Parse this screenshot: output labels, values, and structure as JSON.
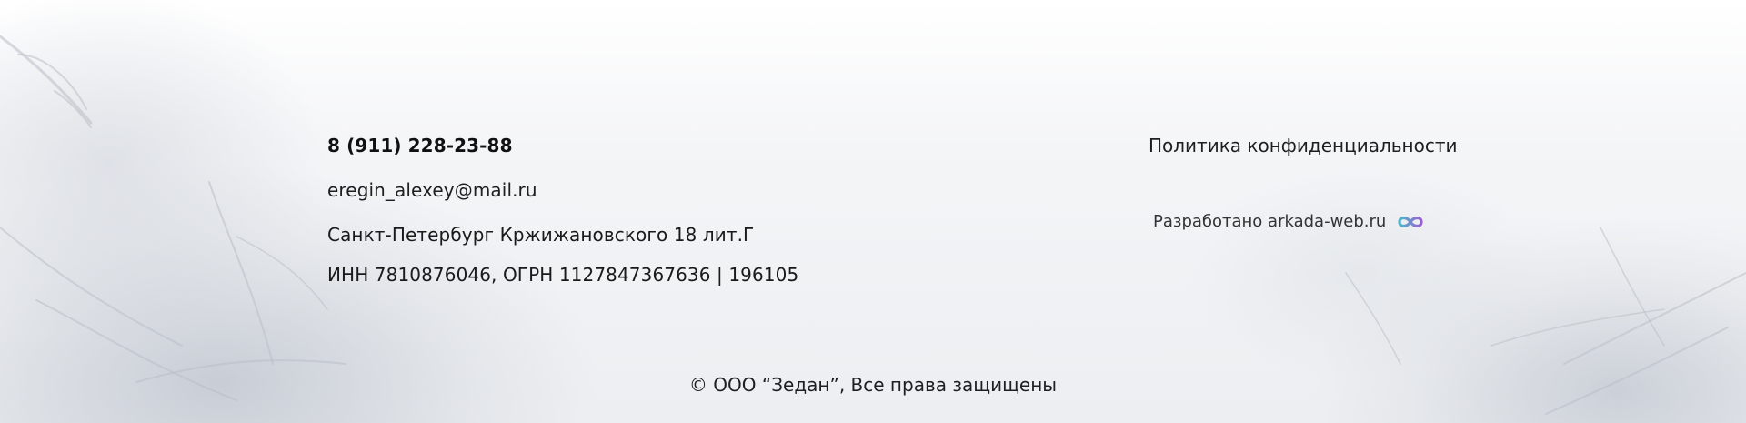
{
  "footer": {
    "phone": "8 (911) 228-23-88",
    "email": "eregin_alexey@mail.ru",
    "address": "Санкт-Петербург Кржижановского 18 лит.Г",
    "requisites": "ИНН 7810876046, ОГРН 1127847367636 | 196105",
    "privacy_link": "Политика конфиденциальности",
    "developer_text": "Разработано arkada-web.ru",
    "developer_logo_icon": "infinity-logo-icon",
    "copyright": "© ООО “Зедан”, Все права защищены"
  },
  "colors": {
    "logo_teal": "#4fb7c9",
    "logo_purple": "#9b5fd0",
    "text": "#1f1f1f"
  }
}
